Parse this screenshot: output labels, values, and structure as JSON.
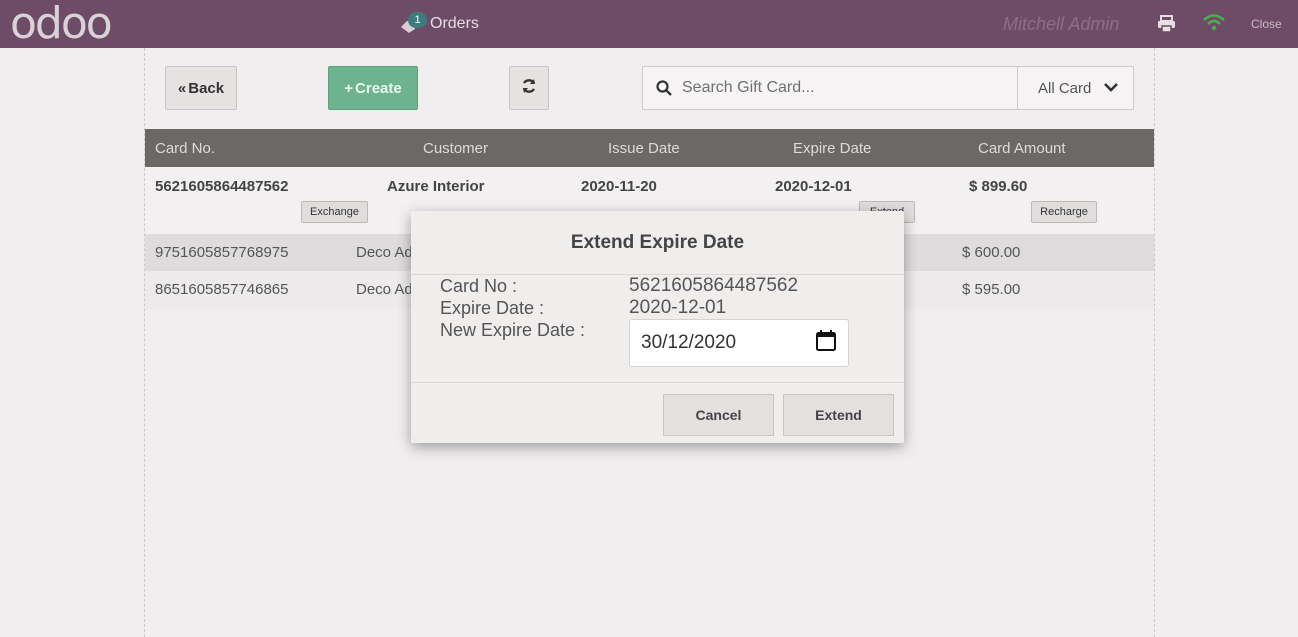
{
  "topbar": {
    "logo": "odoo",
    "orders_label": "Orders",
    "orders_badge": "1",
    "user": "Mitchell Admin",
    "close_label": "Close"
  },
  "toolbar": {
    "back_label": "Back",
    "create_label": "Create",
    "search_placeholder": "Search Gift Card...",
    "filter_value": "All Card"
  },
  "table": {
    "headers": [
      "Card No.",
      "Customer",
      "Issue Date",
      "Expire Date",
      "Card Amount"
    ],
    "rows": [
      {
        "card_no": "5621605864487562",
        "customer": "Azure Interior",
        "issue_date": "2020-11-20",
        "expire_date": "2020-12-01",
        "amount": "$ 899.60",
        "exchange": "Exchange",
        "extend": "Extend",
        "recharge": "Recharge"
      },
      {
        "card_no": "9751605857768975",
        "customer": "Deco Ad",
        "amount": "$ 600.00"
      },
      {
        "card_no": "8651605857746865",
        "customer": "Deco Ad",
        "amount": "$ 595.00"
      }
    ]
  },
  "modal": {
    "title": "Extend Expire Date",
    "card_no_label": "Card No :",
    "card_no_value": "5621605864487562",
    "expire_label": "Expire Date :",
    "expire_value": "2020-12-01",
    "new_expire_label": "New Expire Date :",
    "new_expire_value": "30/12/2020",
    "cancel_label": "Cancel",
    "extend_label": "Extend"
  },
  "colors": {
    "topbar": "#6e4b66",
    "create_button": "#6db38d",
    "table_header": "#6b6868",
    "wifi": "#4caf50"
  }
}
